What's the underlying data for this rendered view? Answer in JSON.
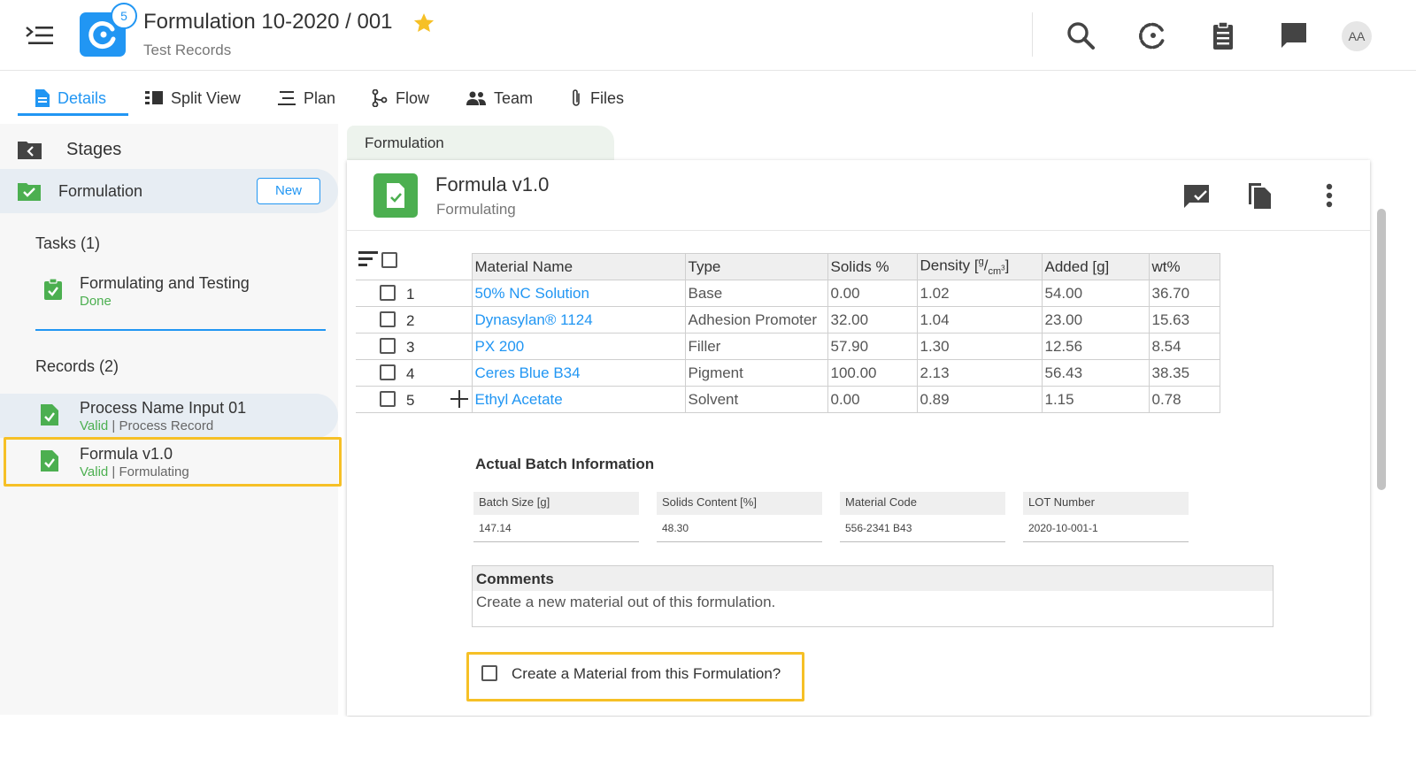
{
  "header": {
    "app_badge": "5",
    "title": "Formulation 10-2020 / 001",
    "subtitle": "Test Records",
    "avatar": "AA",
    "icons": [
      "menu-icon",
      "app-logo-icon",
      "star-icon",
      "search-icon",
      "loading-icon",
      "clipboard-icon",
      "chat-icon"
    ],
    "accent_color": "#2196f3",
    "star_color": "#f6c026"
  },
  "tabs": [
    {
      "label": "Details",
      "icon": "document-icon",
      "active": true
    },
    {
      "label": "Split View",
      "icon": "split-view-icon"
    },
    {
      "label": "Plan",
      "icon": "plan-icon"
    },
    {
      "label": "Flow",
      "icon": "flow-icon"
    },
    {
      "label": "Team",
      "icon": "team-icon"
    },
    {
      "label": "Files",
      "icon": "paperclip-icon"
    }
  ],
  "sidebar": {
    "stages_label": "Stages",
    "stage": {
      "label": "Formulation",
      "new_button": "New"
    },
    "tasks_label": "Tasks (1)",
    "tasks": [
      {
        "name": "Formulating and Testing",
        "status": "Done"
      }
    ],
    "records_label": "Records (2)",
    "records": [
      {
        "name": "Process Name Input 01",
        "status": "Valid",
        "type": "| Process Record"
      },
      {
        "name": "Formula v1.0",
        "status": "Valid",
        "type": "| Formulating"
      }
    ]
  },
  "main": {
    "stage_tab": "Formulation",
    "card_title": "Formula v1.0",
    "card_subtitle": "Formulating",
    "table": {
      "columns": [
        "Material Name",
        "Type",
        "Solids %",
        "Density",
        "Added [g]",
        "wt%"
      ],
      "density_unit_num": "g",
      "density_unit_den": "cm",
      "density_unit_exp": "3",
      "rows": [
        {
          "num": "1",
          "name": "50% NC Solution",
          "type": "Base",
          "solids": "0.00",
          "density": "1.02",
          "added": "54.00",
          "wt": "36.70"
        },
        {
          "num": "2",
          "name": "Dynasylan® 1124",
          "type": "Adhesion Promoter",
          "solids": "32.00",
          "density": "1.04",
          "added": "23.00",
          "wt": "15.63"
        },
        {
          "num": "3",
          "name": "PX 200",
          "type": "Filler",
          "solids": "57.90",
          "density": "1.30",
          "added": "12.56",
          "wt": "8.54"
        },
        {
          "num": "4",
          "name": "Ceres Blue B34",
          "type": "Pigment",
          "solids": "100.00",
          "density": "2.13",
          "added": "56.43",
          "wt": "38.35"
        },
        {
          "num": "5",
          "name": "Ethyl Acetate",
          "type": "Solvent",
          "solids": "0.00",
          "density": "0.89",
          "added": "1.15",
          "wt": "0.78"
        }
      ]
    },
    "batch": {
      "title": "Actual Batch Information",
      "fields": [
        {
          "label": "Batch Size [g]",
          "value": "147.14"
        },
        {
          "label": "Solids Content [%]",
          "value": "48.30"
        },
        {
          "label": "Material Code",
          "value": "556-2341 B43"
        },
        {
          "label": "LOT Number",
          "value": "2020-10-001-1"
        }
      ]
    },
    "comments": {
      "label": "Comments",
      "value": "Create a new material out of this formulation."
    },
    "create_material_label": "Create a Material from this Formulation?"
  }
}
